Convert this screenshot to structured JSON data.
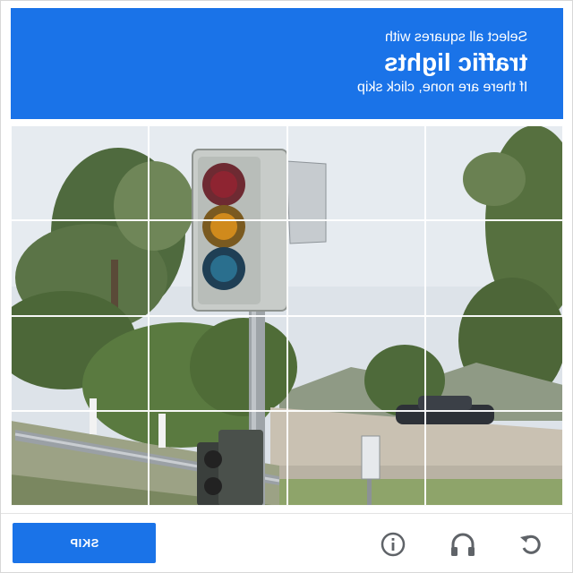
{
  "header": {
    "instruction_small": "Select all squares with",
    "target_object": "traffic lights",
    "instruction_hint": "If there are none, click skip"
  },
  "grid": {
    "rows": 4,
    "columns": 4
  },
  "footer": {
    "skip_label": "SKIP",
    "icons": [
      "info-icon",
      "headphones-audio-icon",
      "reload-icon"
    ]
  },
  "colors": {
    "accent": "#1a73e8",
    "icon_gray": "#5f6368"
  }
}
